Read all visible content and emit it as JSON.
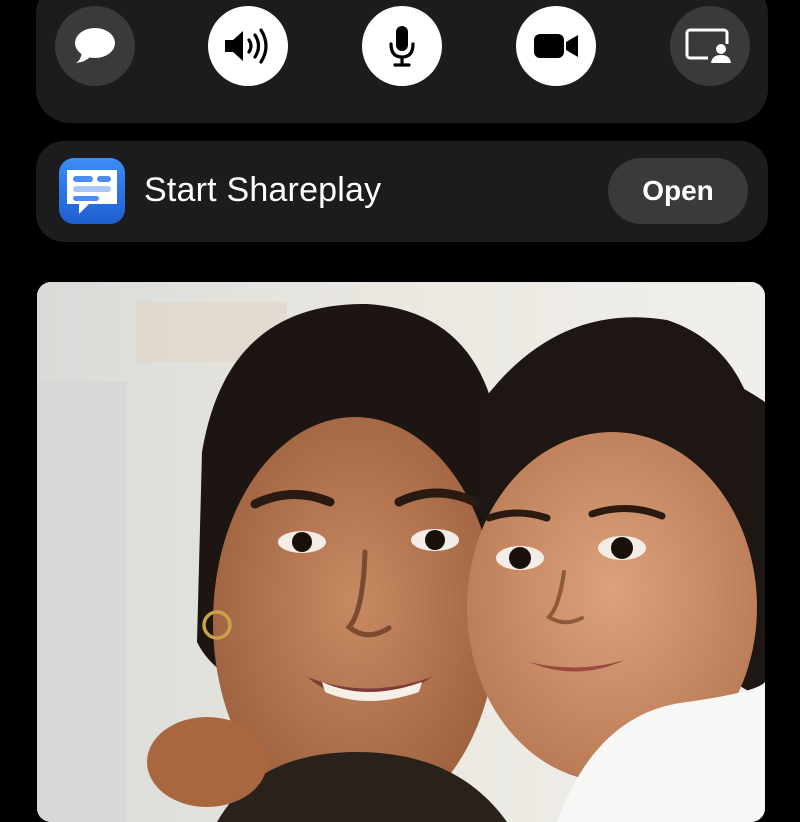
{
  "control_bar": {
    "buttons": [
      {
        "name": "messages",
        "icon": "speech-bubble-icon"
      },
      {
        "name": "audio",
        "icon": "speaker-icon"
      },
      {
        "name": "mute",
        "icon": "microphone-icon"
      },
      {
        "name": "camera",
        "icon": "video-camera-icon"
      },
      {
        "name": "share-screen",
        "icon": "share-screen-icon"
      }
    ]
  },
  "shareplay": {
    "app_icon": "shareplay-app-icon",
    "label": "Start Shareplay",
    "open_label": "Open"
  },
  "colors": {
    "background": "#000000",
    "panel": "#1c1c1e",
    "button_dark": "#3a3a3c",
    "button_light": "#ffffff",
    "text": "#ffffff"
  }
}
